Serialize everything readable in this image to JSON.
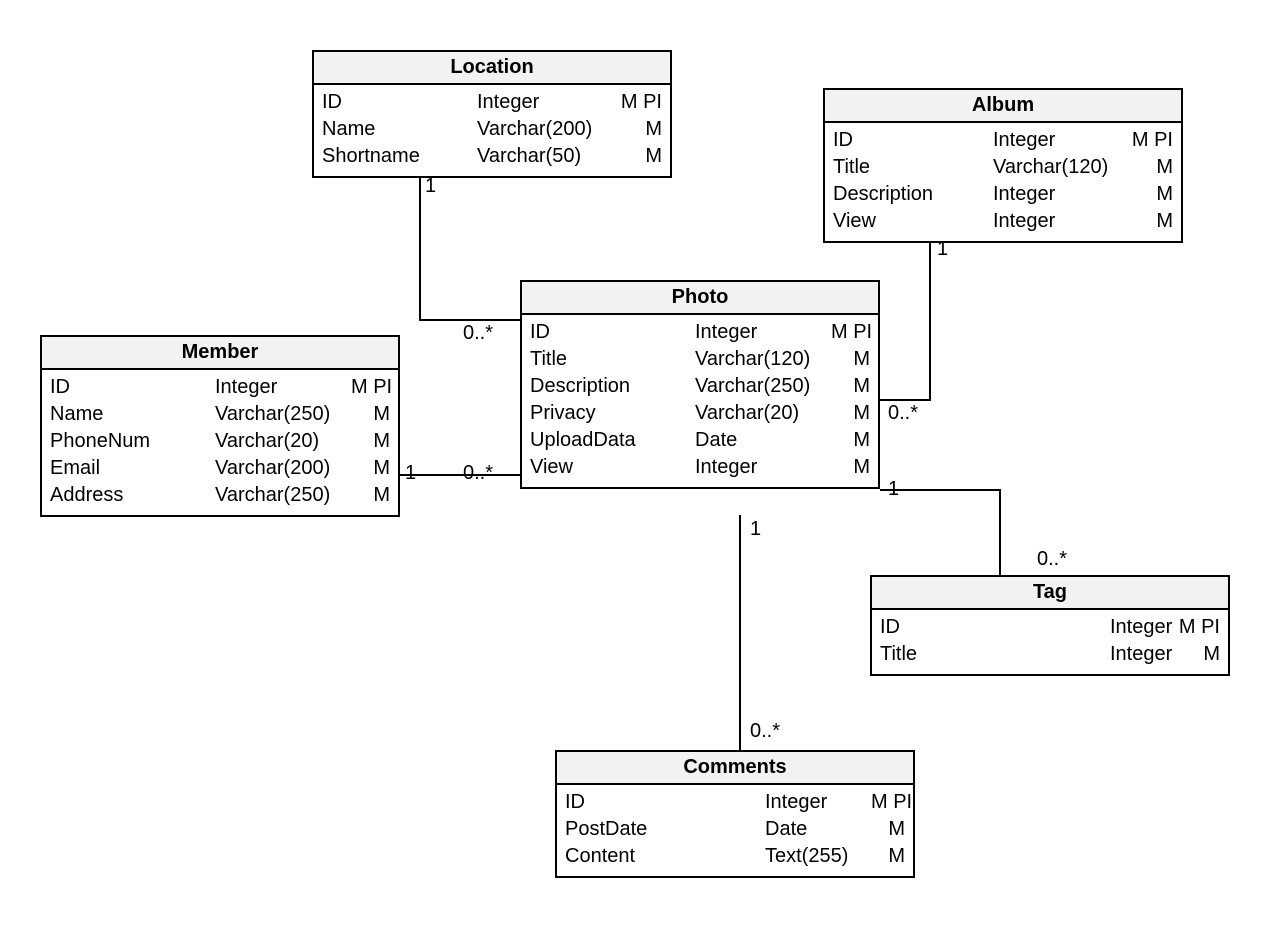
{
  "entities": {
    "location": {
      "title": "Location",
      "attrs": [
        {
          "name": "ID",
          "type": "Integer",
          "flags": "M PI"
        },
        {
          "name": "Name",
          "type": "Varchar(200)",
          "flags": "M"
        },
        {
          "name": "Shortname",
          "type": "Varchar(50)",
          "flags": "M"
        }
      ]
    },
    "album": {
      "title": "Album",
      "attrs": [
        {
          "name": "ID",
          "type": "Integer",
          "flags": "M PI"
        },
        {
          "name": "Title",
          "type": "Varchar(120)",
          "flags": "M"
        },
        {
          "name": "Description",
          "type": "Integer",
          "flags": "M"
        },
        {
          "name": "View",
          "type": "Integer",
          "flags": "M"
        }
      ]
    },
    "member": {
      "title": "Member",
      "attrs": [
        {
          "name": "ID",
          "type": "Integer",
          "flags": "M PI"
        },
        {
          "name": "Name",
          "type": "Varchar(250)",
          "flags": "M"
        },
        {
          "name": "PhoneNum",
          "type": "Varchar(20)",
          "flags": "M"
        },
        {
          "name": "Email",
          "type": "Varchar(200)",
          "flags": "M"
        },
        {
          "name": "Address",
          "type": "Varchar(250)",
          "flags": "M"
        }
      ]
    },
    "photo": {
      "title": "Photo",
      "attrs": [
        {
          "name": "ID",
          "type": "Integer",
          "flags": "M PI"
        },
        {
          "name": "Title",
          "type": "Varchar(120)",
          "flags": "M"
        },
        {
          "name": "Description",
          "type": "Varchar(250)",
          "flags": "M"
        },
        {
          "name": "Privacy",
          "type": "Varchar(20)",
          "flags": "M"
        },
        {
          "name": "UploadData",
          "type": "Date",
          "flags": "M"
        },
        {
          "name": "View",
          "type": "Integer",
          "flags": "M"
        }
      ]
    },
    "tag": {
      "title": "Tag",
      "attrs": [
        {
          "name": "ID",
          "type": "Integer",
          "flags": "M PI"
        },
        {
          "name": "Title",
          "type": "Integer",
          "flags": "M"
        }
      ]
    },
    "comments": {
      "title": "Comments",
      "attrs": [
        {
          "name": "ID",
          "type": "Integer",
          "flags": "M PI"
        },
        {
          "name": "PostDate",
          "type": "Date",
          "flags": "M"
        },
        {
          "name": "Content",
          "type": "Text(255)",
          "flags": "M"
        }
      ]
    }
  },
  "cardinalities": {
    "loc_one": "1",
    "loc_many": "0..*",
    "mem_one": "1",
    "mem_many": "0..*",
    "alb_one": "1",
    "alb_many": "0..*",
    "tag_one": "1",
    "tag_many": "0..*",
    "com_one": "1",
    "com_many": "0..*"
  }
}
